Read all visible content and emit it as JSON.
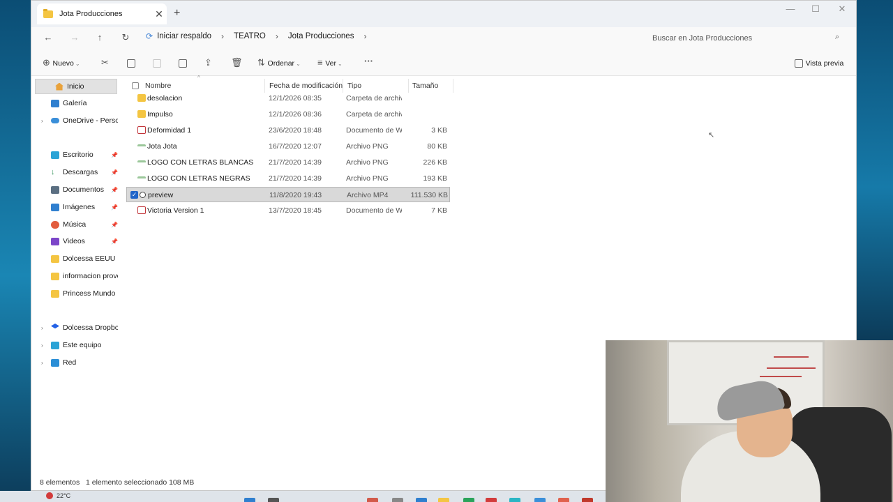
{
  "window": {
    "tab_title": "Jota Producciones",
    "tab_close": "✕",
    "new_tab": "+",
    "controls": {
      "minimize": "—",
      "maximize": "☐",
      "close": "✕"
    }
  },
  "nav": {
    "back": "←",
    "forward": "→",
    "up": "↑",
    "refresh": "↻",
    "breadcrumb": [
      "Iniciar respaldo",
      "TEATRO",
      "Jota Producciones"
    ],
    "search_placeholder": "Buscar en Jota Producciones"
  },
  "toolbar": {
    "new_label": "Nuevo",
    "sort_label": "Ordenar",
    "view_label": "Ver",
    "more": "···",
    "preview_label": "Vista previa"
  },
  "sidebar": {
    "items": [
      {
        "label": "Inicio",
        "icon": "home-icon",
        "active": true
      },
      {
        "label": "Galería",
        "icon": "gallery-icon"
      },
      {
        "label": "OneDrive - Persona",
        "icon": "onedrive-icon",
        "expand": true
      },
      {
        "label": "Escritorio",
        "icon": "desktop-icon",
        "pinned": true
      },
      {
        "label": "Descargas",
        "icon": "download-icon",
        "pinned": true
      },
      {
        "label": "Documentos",
        "icon": "documents-icon",
        "pinned": true
      },
      {
        "label": "Imágenes",
        "icon": "pictures-icon",
        "pinned": true
      },
      {
        "label": "Música",
        "icon": "music-icon",
        "pinned": true
      },
      {
        "label": "Videos",
        "icon": "videos-icon",
        "pinned": true
      },
      {
        "label": "Dolcessa EEUU",
        "icon": "folder-icon"
      },
      {
        "label": "informacion provee",
        "icon": "folder-icon"
      },
      {
        "label": "Princess Mundo Im",
        "icon": "folder-icon"
      },
      {
        "label": "Dolcessa Dropbox",
        "icon": "dropbox-icon",
        "expand": true
      },
      {
        "label": "Este equipo",
        "icon": "pc-icon",
        "expand": true
      },
      {
        "label": "Red",
        "icon": "network-icon",
        "expand": true
      }
    ]
  },
  "columns": {
    "name": "Nombre",
    "date": "Fecha de modificación",
    "type": "Tipo",
    "size": "Tamaño"
  },
  "files": [
    {
      "name": "desolacion",
      "date": "12/1/2026 08:35",
      "type": "Carpeta de archivos",
      "size": "",
      "kind": "folder"
    },
    {
      "name": "Impulso",
      "date": "12/1/2026 08:36",
      "type": "Carpeta de archivos",
      "size": "",
      "kind": "folder"
    },
    {
      "name": "Deformidad 1",
      "date": "23/6/2020 18:48",
      "type": "Documento de W...",
      "size": "3 KB",
      "kind": "word"
    },
    {
      "name": "Jota Jota",
      "date": "16/7/2020 12:07",
      "type": "Archivo PNG",
      "size": "80 KB",
      "kind": "png"
    },
    {
      "name": "LOGO CON LETRAS BLANCAS",
      "date": "21/7/2020 14:39",
      "type": "Archivo PNG",
      "size": "226 KB",
      "kind": "png"
    },
    {
      "name": "LOGO CON LETRAS NEGRAS",
      "date": "21/7/2020 14:39",
      "type": "Archivo PNG",
      "size": "193 KB",
      "kind": "png"
    },
    {
      "name": "preview",
      "date": "11/8/2020 19:43",
      "type": "Archivo MP4",
      "size": "111.530 KB",
      "kind": "mp4",
      "selected": true
    },
    {
      "name": "Victoria Version 1",
      "date": "13/7/2020 18:45",
      "type": "Documento de W...",
      "size": "7 KB",
      "kind": "word"
    }
  ],
  "status": {
    "count": "8 elementos",
    "selection": "1 elemento seleccionado  108 MB"
  },
  "taskbar": {
    "weather": "22°C"
  },
  "colors": {
    "accent": "#1f64c8",
    "folder": "#f4c542",
    "selected_row": "#d9d9d9"
  }
}
